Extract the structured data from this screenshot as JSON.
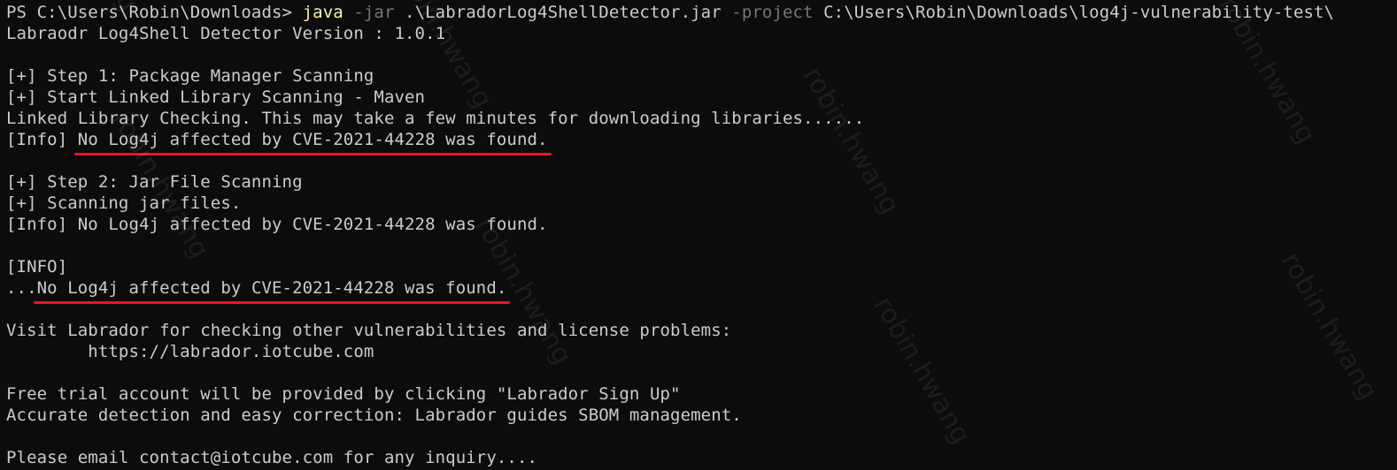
{
  "terminal": {
    "prompt": "PS C:\\Users\\Robin\\Downloads> ",
    "command": "java",
    "flag_jar": " -jar",
    "jar_path": " .\\LabradorLog4ShellDetector.jar",
    "flag_project": " -project",
    "project_path": " C:\\Users\\Robin\\Downloads\\log4j-vulnerability-test\\",
    "version_line": "Labraodr Log4Shell Detector Version : 1.0.1",
    "step1": "[+] Step 1: Package Manager Scanning",
    "step1_sub": "[+] Start Linked Library Scanning - Maven",
    "linked_check": "Linked Library Checking. This may take a few minutes for downloading libraries......",
    "info_prefix_1": "[Info] ",
    "info_result_1": "No Log4j affected by CVE-2021-44228 was found.",
    "step2": "[+] Step 2: Jar File Scanning",
    "step2_sub": "[+] Scanning jar files.",
    "info_result_2": "[Info] No Log4j affected by CVE-2021-44228 was found.",
    "info_header": "[INFO]",
    "final_prefix": "...",
    "final_result": "No Log4j affected by CVE-2021-44228 was found.",
    "visit_line": "Visit Labrador for checking other vulnerabilities and license problems:",
    "visit_url": "        https://labrador.iotcube.com",
    "trial_line": "Free trial account will be provided by clicking \"Labrador Sign Up\"",
    "accurate_line": "Accurate detection and easy correction: Labrador guides SBOM management.",
    "email_line": "Please email contact@iotcube.com for any inquiry...."
  },
  "watermark": {
    "text": "robin.hwang"
  },
  "colors": {
    "background": "#0c0c0c",
    "foreground": "#cccccc",
    "command": "#f9f1a5",
    "flag": "#767676",
    "underline": "#e21b2a"
  }
}
